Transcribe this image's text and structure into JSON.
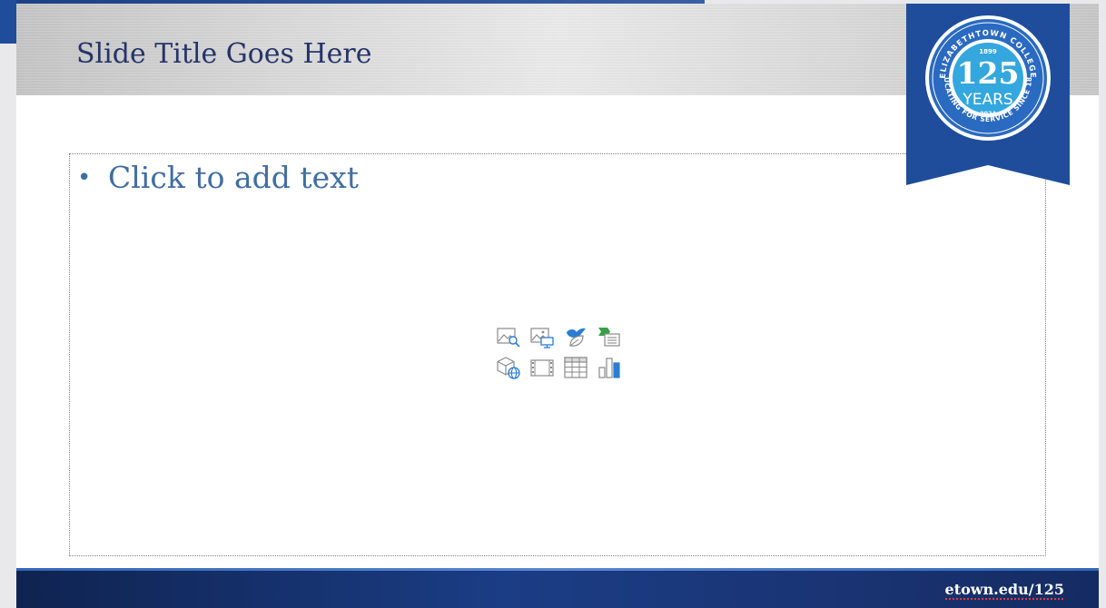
{
  "slide": {
    "title": "Slide Title Goes Here",
    "body_bullet": "•",
    "body_placeholder": "Click to add text"
  },
  "insert_icons": [
    {
      "name": "insert-picture-search-icon",
      "tooltip": "Stock Images"
    },
    {
      "name": "insert-picture-icon",
      "tooltip": "Pictures"
    },
    {
      "name": "insert-icons-icon",
      "tooltip": "Insert an Icon"
    },
    {
      "name": "insert-smartart-icon",
      "tooltip": "Insert a SmartArt Graphic"
    },
    {
      "name": "insert-3d-model-icon",
      "tooltip": "3D Models"
    },
    {
      "name": "insert-video-icon",
      "tooltip": "Insert Video"
    },
    {
      "name": "insert-table-icon",
      "tooltip": "Insert Table"
    },
    {
      "name": "insert-chart-icon",
      "tooltip": "Insert Chart"
    }
  ],
  "badge": {
    "arc_top": "ELIZABETHTOWN COLLEGE",
    "arc_bottom": "EDUCATING FOR SERVICE SINCE 1899",
    "year_start": "1899",
    "number": "125",
    "word": "YEARS",
    "year_end": "2024"
  },
  "footer": {
    "url": "etown.edu/125"
  },
  "colors": {
    "title_text": "#24346a",
    "body_text": "#3f6ea4",
    "brand_blue": "#1f4d9c",
    "badge_blue": "#33a7de",
    "footer_dark": "#0f2350"
  }
}
